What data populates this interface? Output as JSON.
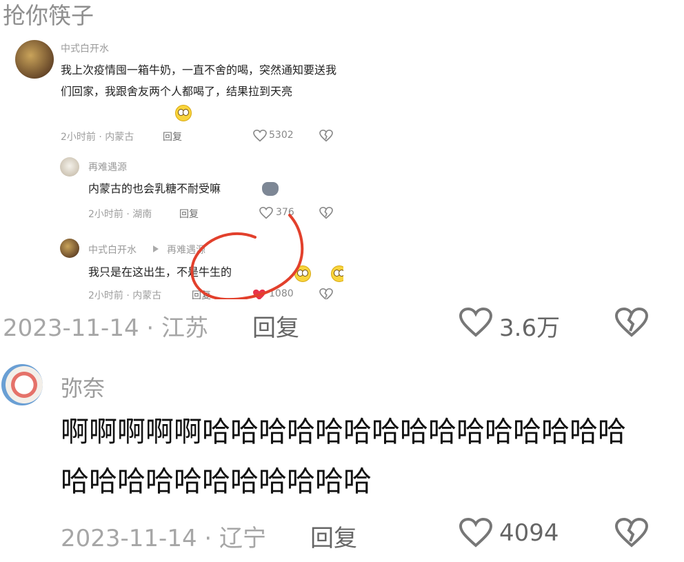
{
  "top_fragment": "抢你筷子",
  "embedded": {
    "c1": {
      "user": "中式白开水",
      "text": "我上次疫情囤一箱牛奶，一直不舍的喝，突然通知要送我们回家，我跟舍友两个人都喝了，结果拉到天亮",
      "meta": "2小时前 · 内蒙古",
      "reply": "回复",
      "likes": "5302"
    },
    "c2": {
      "user": "再难遇源",
      "text": "内蒙古的也会乳糖不耐受嘛",
      "meta": "2小时前 · 湖南",
      "reply": "回复",
      "likes": "376"
    },
    "c3": {
      "user": "中式白开水",
      "to": "再难遇源",
      "text": "我只是在这出生，不是牛生的",
      "meta": "2小时前 · 内蒙古",
      "reply": "回复",
      "likes": "1080"
    }
  },
  "comment1": {
    "date": "2023-11-14 · 江苏",
    "reply": "回复",
    "likes": "3.6万"
  },
  "comment2": {
    "user": "弥奈",
    "text": "啊啊啊啊啊哈哈哈哈哈哈哈哈哈哈哈哈哈哈哈哈哈哈哈哈哈哈哈哈哈哈",
    "date": "2023-11-14 · 辽宁",
    "reply": "回复",
    "likes": "4094"
  },
  "colors": {
    "annotation_circle": "#e2402c",
    "liked_heart": "#e8334a"
  },
  "icons": [
    "heart-outline-icon",
    "broken-heart-icon",
    "play-triangle-icon"
  ]
}
